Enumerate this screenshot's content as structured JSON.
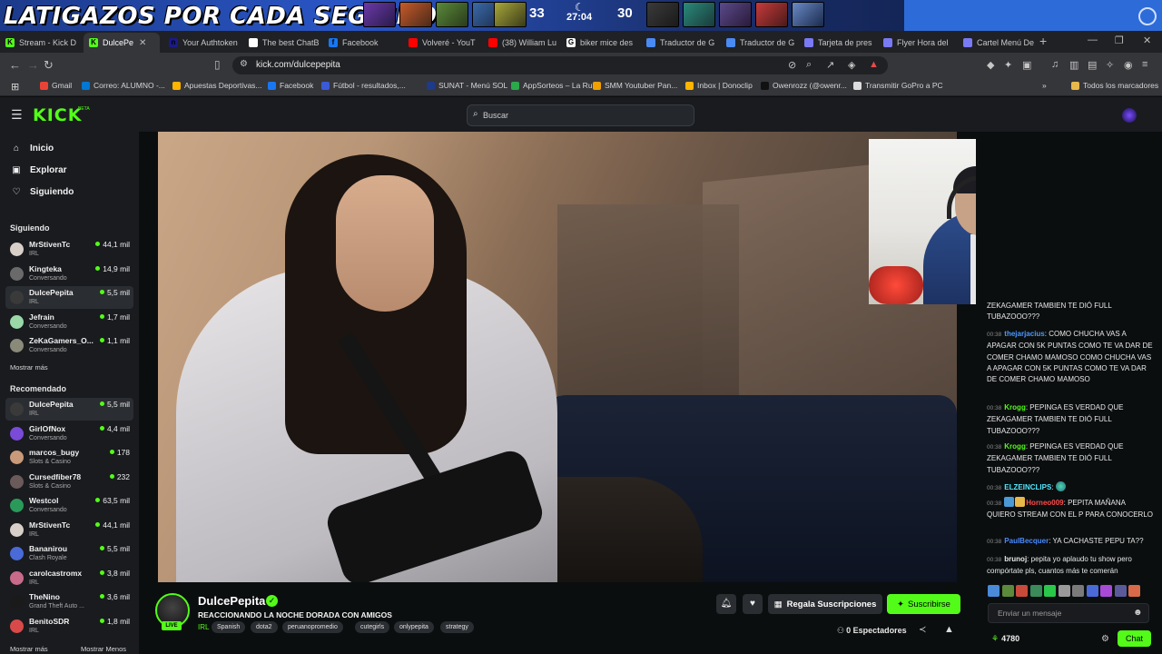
{
  "overlay": {
    "title": "LATIGAZOS POR CADA SEGUIDOR",
    "score_left": "33",
    "score_right": "30",
    "game_time": "27:04"
  },
  "tabs": [
    {
      "label": "Stream - Kick D",
      "color": "#53fc18",
      "letter": "K"
    },
    {
      "label": "DulcePe",
      "color": "#53fc18",
      "letter": "K",
      "active": true
    },
    {
      "label": "Your Authtoken",
      "color": "#1a1a8a",
      "letter": "n"
    },
    {
      "label": "The best ChatB",
      "color": "#ffffff",
      "letter": ""
    },
    {
      "label": "Facebook",
      "color": "#1877f2",
      "letter": "f"
    },
    {
      "label": "Volveré - YouT",
      "color": "#ff0000",
      "letter": ""
    },
    {
      "label": "(38) William Lu",
      "color": "#ff0000",
      "letter": ""
    },
    {
      "label": "biker mice des",
      "color": "#ffffff",
      "letter": "G"
    },
    {
      "label": "Traductor de G",
      "color": "#4a8af4",
      "letter": ""
    },
    {
      "label": "Traductor de G",
      "color": "#4a8af4",
      "letter": ""
    },
    {
      "label": "Tarjeta de pres",
      "color": "#7a7af4",
      "letter": ""
    },
    {
      "label": "Flyer Hora del",
      "color": "#7a7af4",
      "letter": ""
    },
    {
      "label": "Cartel Menú De",
      "color": "#7a7af4",
      "letter": ""
    }
  ],
  "address": {
    "url": "kick.com/dulcepepita"
  },
  "bookmarks": [
    {
      "label": "Gmail",
      "color": "#ea4335"
    },
    {
      "label": "Correo: ALUMNO -...",
      "color": "#0078d4"
    },
    {
      "label": "Apuestas Deportivas...",
      "color": "#ffb400"
    },
    {
      "label": "Facebook",
      "color": "#1877f2"
    },
    {
      "label": "Fútbol - resultados,...",
      "color": "#3a5ad8"
    },
    {
      "label": "SUNAT - Menú SOL",
      "color": "#1e3a8a"
    },
    {
      "label": "AppSorteos – La Rul...",
      "color": "#2aa84a"
    },
    {
      "label": "SMM Youtuber Pan...",
      "color": "#f0a000"
    },
    {
      "label": "Inbox | Donoclip",
      "color": "#ffb400"
    },
    {
      "label": "Owenrozz (@owenr...",
      "color": "#111111"
    },
    {
      "label": "Transmitir GoPro a PC",
      "color": "#dddddd"
    }
  ],
  "bookmarks_all": "Todos los marcadores",
  "kick": {
    "logo": "KICK",
    "beta": "BETA",
    "search_placeholder": "Buscar"
  },
  "sidebar": {
    "nav": [
      {
        "label": "Inicio",
        "icon": "home-icon",
        "glyph": "⌂"
      },
      {
        "label": "Explorar",
        "icon": "compass-icon",
        "glyph": "▣"
      },
      {
        "label": "Siguiendo",
        "icon": "heart-icon",
        "glyph": "♡"
      }
    ],
    "following_label": "Siguiendo",
    "following": [
      {
        "name": "MrStivenTc",
        "category": "IRL",
        "viewers": "44,1 mil",
        "color": "#d8d0c8"
      },
      {
        "name": "Kingteka",
        "category": "Conversando",
        "viewers": "14,9 mil",
        "color": "#6a6a6a"
      },
      {
        "name": "DulcePepita",
        "category": "IRL",
        "viewers": "5,5 mil",
        "color": "#3a3a3a",
        "active": true
      },
      {
        "name": "Jefrain",
        "category": "Conversando",
        "viewers": "1,7 mil",
        "color": "#9ad8a8"
      },
      {
        "name": "ZeKaGamers_O...",
        "category": "Conversando",
        "viewers": "1,1 mil",
        "color": "#8a8a7a"
      }
    ],
    "following_more": "Mostrar más",
    "recommended_label": "Recomendado",
    "recommended": [
      {
        "name": "DulcePepita",
        "category": "IRL",
        "viewers": "5,5 mil",
        "color": "#3a3a3a",
        "active": true
      },
      {
        "name": "GirlOfNox",
        "category": "Conversando",
        "viewers": "4,4 mil",
        "color": "#7a4ad8"
      },
      {
        "name": "marcos_bugy",
        "category": "Slots & Casino",
        "viewers": "178",
        "color": "#c89a7a"
      },
      {
        "name": "Cursedfiber78",
        "category": "Slots & Casino",
        "viewers": "232",
        "color": "#6a5a5a"
      },
      {
        "name": "Westcol",
        "category": "Conversando",
        "viewers": "63,5 mil",
        "color": "#2a9a5a"
      },
      {
        "name": "MrStivenTc",
        "category": "IRL",
        "viewers": "44,1 mil",
        "color": "#d8d0c8"
      },
      {
        "name": "Bananirou",
        "category": "Clash Royale",
        "viewers": "5,5 mil",
        "color": "#4a6ad8"
      },
      {
        "name": "carolcastromx",
        "category": "IRL",
        "viewers": "3,8 mil",
        "color": "#c86a8a"
      },
      {
        "name": "TheNino",
        "category": "Grand Theft Auto ...",
        "viewers": "3,6 mil",
        "color": "#1a1a1a"
      },
      {
        "name": "BenitoSDR",
        "category": "IRL",
        "viewers": "1,8 mil",
        "color": "#d84a4a"
      }
    ],
    "recommended_more": "Mostrar más",
    "recommended_less": "Mostrar Menos"
  },
  "stream": {
    "streamer": "DulcePepita",
    "live": "LIVE",
    "title": "REACCIONANDO LA NOCHE DORADA CON AMIGOS",
    "category": "IRL",
    "tags": [
      "Spanish",
      "dota2",
      "peruanopromedio",
      "cutegirls",
      "onlypepita",
      "strategy"
    ],
    "gift_label": "Regala Suscripciones",
    "subscribe_label": "Suscribirse",
    "viewers_label": "0 Espectadores"
  },
  "chat": {
    "messages": [
      {
        "time": "",
        "user": "",
        "color": "#e8e8e8",
        "text": "ZEKAGAMER TAMBIEN TE DIÓ FULL TUBAZOOO???"
      },
      {
        "time": "00:38",
        "user": "thejarjacius",
        "color": "#4a9aff",
        "text": "COMO CHUCHA VAS A APAGAR CON 5K PUNTAS COMO TE VA DAR DE COMER CHAMO MAMOSO COMO CHUCHA VAS A APAGAR CON 5K PUNTAS COMO TE VA DAR DE COMER CHAMO MAMOSO"
      },
      {
        "time": "00:38",
        "user": "Krogg",
        "color": "#53fc18",
        "text": "PEPINGA ES VERDAD QUE ZEKAGAMER TAMBIEN TE DIÓ FULL TUBAZOOO???"
      },
      {
        "time": "00:38",
        "user": "Krogg",
        "color": "#53fc18",
        "text": "PEPINGA ES VERDAD QUE ZEKAGAMER TAMBIEN TE DIÓ FULL TUBAZOOO???"
      },
      {
        "time": "00:38",
        "user": "ELZEINCLIPS",
        "color": "#53e8ff",
        "text": ""
      },
      {
        "time": "00:38",
        "user": "Horneo009",
        "color": "#ff4a4a",
        "text": "PEPITA MAÑANA QUIERO STREAM CON EL P PARA CONOCERLO"
      },
      {
        "time": "00:38",
        "user": "PaulBecquer",
        "color": "#4a8aff",
        "text": "YA CACHASTE PEPU TA??"
      },
      {
        "time": "00:38",
        "user": "brunoj",
        "color": "#e8e8e8",
        "text": "pepita yo aplaudo tu show pero compórtate pls, cuantos más te comerán"
      }
    ],
    "input_placeholder": "Enviar un mensaje",
    "points": "4780",
    "chat_button": "Chat"
  }
}
